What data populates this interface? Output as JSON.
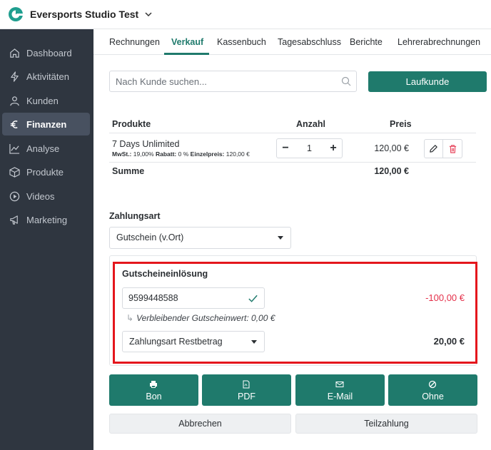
{
  "header": {
    "studio_name": "Eversports Studio Test"
  },
  "sidebar": {
    "items": [
      {
        "label": "Dashboard",
        "icon": "home-icon"
      },
      {
        "label": "Aktivitäten",
        "icon": "lightning-icon"
      },
      {
        "label": "Kunden",
        "icon": "user-icon"
      },
      {
        "label": "Finanzen",
        "icon": "euro-icon",
        "active": true
      },
      {
        "label": "Analyse",
        "icon": "chart-line-icon"
      },
      {
        "label": "Produkte",
        "icon": "box-icon"
      },
      {
        "label": "Videos",
        "icon": "play-icon"
      },
      {
        "label": "Marketing",
        "icon": "megaphone-icon"
      }
    ]
  },
  "tabs": [
    {
      "label": "Rechnungen"
    },
    {
      "label": "Verkauf",
      "active": true
    },
    {
      "label": "Kassenbuch"
    },
    {
      "label": "Tagesabschluss"
    },
    {
      "label": "Berichte"
    },
    {
      "label": "Lehrerabrechnungen"
    }
  ],
  "search": {
    "placeholder": "Nach Kunde suchen..."
  },
  "walkin_button": "Laufkunde",
  "table": {
    "headers": {
      "product": "Produkte",
      "quantity": "Anzahl",
      "price": "Preis"
    },
    "rows": [
      {
        "name": "7 Days Unlimited",
        "vat_label": "MwSt.:",
        "vat_value": "19,00%",
        "discount_label": "Rabatt:",
        "discount_value": "0 %",
        "unit_label": "Einzelpreis:",
        "unit_value": "120,00 €",
        "quantity": "1",
        "price": "120,00 €"
      }
    ],
    "sum_label": "Summe",
    "sum_value": "120,00 €"
  },
  "payment": {
    "label": "Zahlungsart",
    "selected": "Gutschein (v.Ort)"
  },
  "voucher": {
    "title": "Gutscheineinlösung",
    "code": "9599448588",
    "amount": "-100,00 €",
    "remaining_text": "Verbleibender Gutscheinwert: 0,00 €",
    "rest_payment_placeholder": "Zahlungsart Restbetrag",
    "rest_amount": "20,00 €"
  },
  "actions": [
    {
      "label": "Bon",
      "icon": "printer-icon"
    },
    {
      "label": "PDF",
      "icon": "pdf-icon"
    },
    {
      "label": "E-Mail",
      "icon": "mail-icon"
    },
    {
      "label": "Ohne",
      "icon": "no-entry-icon"
    }
  ],
  "footer": {
    "cancel": "Abbrechen",
    "partial": "Teilzahlung"
  },
  "colors": {
    "accent": "#1f7a6c",
    "sidebar": "#2f3640",
    "highlight": "#e4161c",
    "negative": "#e4304a"
  }
}
